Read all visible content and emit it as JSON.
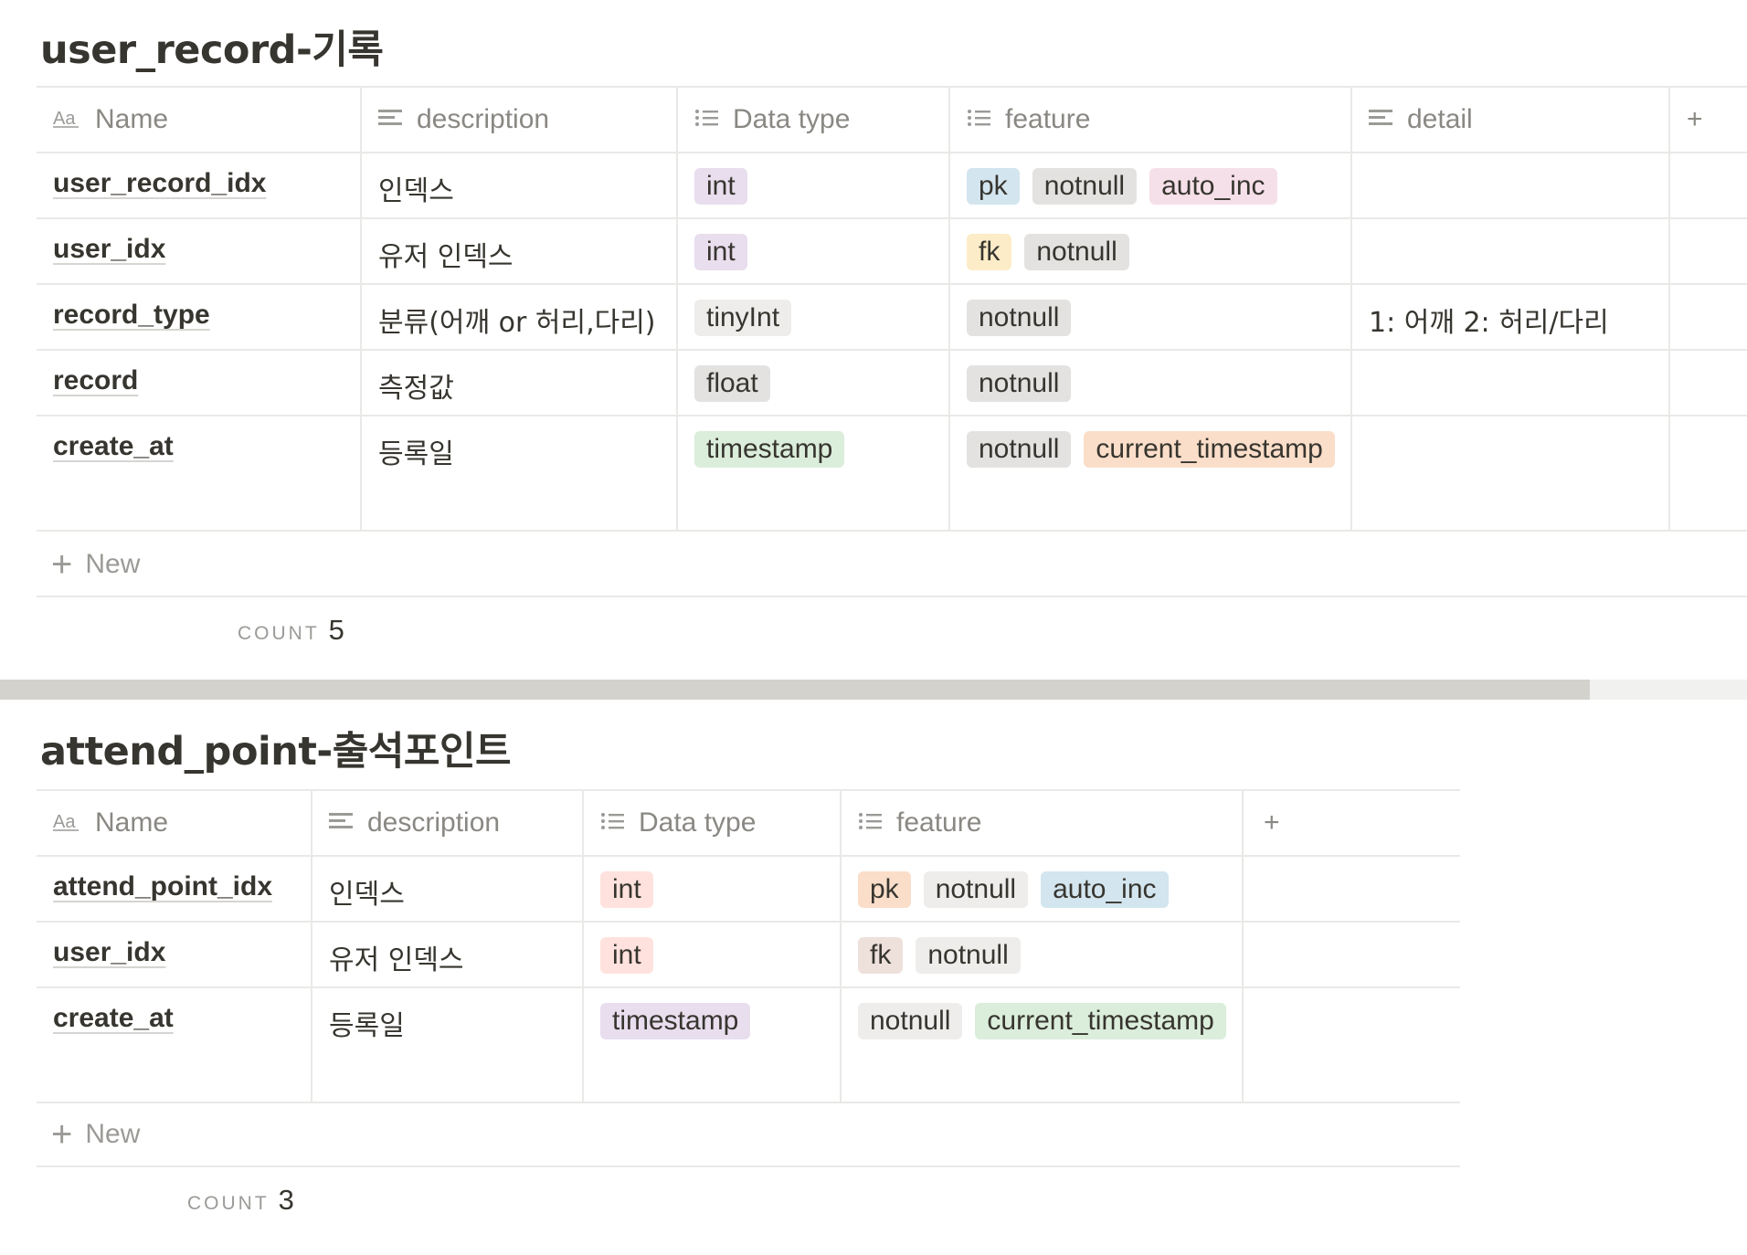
{
  "databases": [
    {
      "title": "user_record-기록",
      "headers": {
        "name": "Name",
        "description": "description",
        "data_type": "Data type",
        "feature": "feature",
        "detail": "detail",
        "add_column": "+"
      },
      "rows": [
        {
          "name": "user_record_idx",
          "description": "인덱스",
          "data_type": {
            "label": "int",
            "color": "purple"
          },
          "features": [
            {
              "label": "pk",
              "color": "blue"
            },
            {
              "label": "notnull",
              "color": "gray"
            },
            {
              "label": "auto_inc",
              "color": "pink"
            }
          ],
          "detail": ""
        },
        {
          "name": "user_idx",
          "description": "유저 인덱스",
          "data_type": {
            "label": "int",
            "color": "purple"
          },
          "features": [
            {
              "label": "fk",
              "color": "yellow"
            },
            {
              "label": "notnull",
              "color": "gray"
            }
          ],
          "detail": ""
        },
        {
          "name": "record_type",
          "description": "분류(어깨 or 허리,다리)",
          "data_type": {
            "label": "tinyInt",
            "color": "lightgray"
          },
          "features": [
            {
              "label": "notnull",
              "color": "gray"
            }
          ],
          "detail": "1: 어깨 2: 허리/다리"
        },
        {
          "name": "record",
          "description": "측정값",
          "data_type": {
            "label": "float",
            "color": "gray"
          },
          "features": [
            {
              "label": "notnull",
              "color": "gray"
            }
          ],
          "detail": ""
        },
        {
          "name": "create_at",
          "description": "등록일",
          "data_type": {
            "label": "timestamp",
            "color": "green"
          },
          "features": [
            {
              "label": "notnull",
              "color": "gray"
            },
            {
              "label": "current_timestamp",
              "color": "orange"
            }
          ],
          "detail": ""
        }
      ],
      "new_label": "New",
      "count_label": "COUNT",
      "count_value": "5"
    },
    {
      "title": "attend_point-출석포인트",
      "headers": {
        "name": "Name",
        "description": "description",
        "data_type": "Data type",
        "feature": "feature",
        "add_column": "+"
      },
      "rows": [
        {
          "name": "attend_point_idx",
          "description": "인덱스",
          "data_type": {
            "label": "int",
            "color": "red"
          },
          "features": [
            {
              "label": "pk",
              "color": "orange"
            },
            {
              "label": "notnull",
              "color": "lightgray"
            },
            {
              "label": "auto_inc",
              "color": "blue"
            }
          ]
        },
        {
          "name": "user_idx",
          "description": "유저 인덱스",
          "data_type": {
            "label": "int",
            "color": "red"
          },
          "features": [
            {
              "label": "fk",
              "color": "brown"
            },
            {
              "label": "notnull",
              "color": "lightgray"
            }
          ]
        },
        {
          "name": "create_at",
          "description": "등록일",
          "data_type": {
            "label": "timestamp",
            "color": "purple"
          },
          "features": [
            {
              "label": "notnull",
              "color": "lightgray"
            },
            {
              "label": "current_timestamp",
              "color": "green"
            }
          ]
        }
      ],
      "new_label": "New",
      "count_label": "COUNT",
      "count_value": "3"
    }
  ]
}
